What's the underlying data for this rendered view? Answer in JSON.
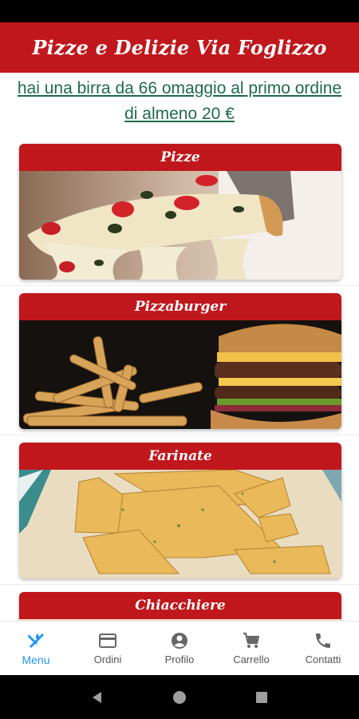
{
  "app": {
    "title": "Pizze e Delizie Via Foglizzo"
  },
  "promo": {
    "text": "hai una birra da 66 omaggio al primo ordine di almeno 20 €"
  },
  "categories": [
    {
      "label": "Pizze",
      "image": "pizza-slice-photo"
    },
    {
      "label": "Pizzaburger",
      "image": "burger-and-fries-photo"
    },
    {
      "label": "Farinate",
      "image": "farinata-photo"
    },
    {
      "label": "Chiacchiere",
      "image": "chiacchiere-photo"
    }
  ],
  "bottom_nav": {
    "active": "Menu",
    "items": [
      {
        "label": "Menu",
        "icon": "utensils-icon"
      },
      {
        "label": "Ordini",
        "icon": "credit-card-icon"
      },
      {
        "label": "Profilo",
        "icon": "account-circle-icon"
      },
      {
        "label": "Carrello",
        "icon": "cart-icon"
      },
      {
        "label": "Contatti",
        "icon": "phone-icon"
      }
    ]
  },
  "colors": {
    "brand": "#c0171c",
    "promo_link": "#1e6b4a",
    "active_nav": "#2196f3"
  }
}
